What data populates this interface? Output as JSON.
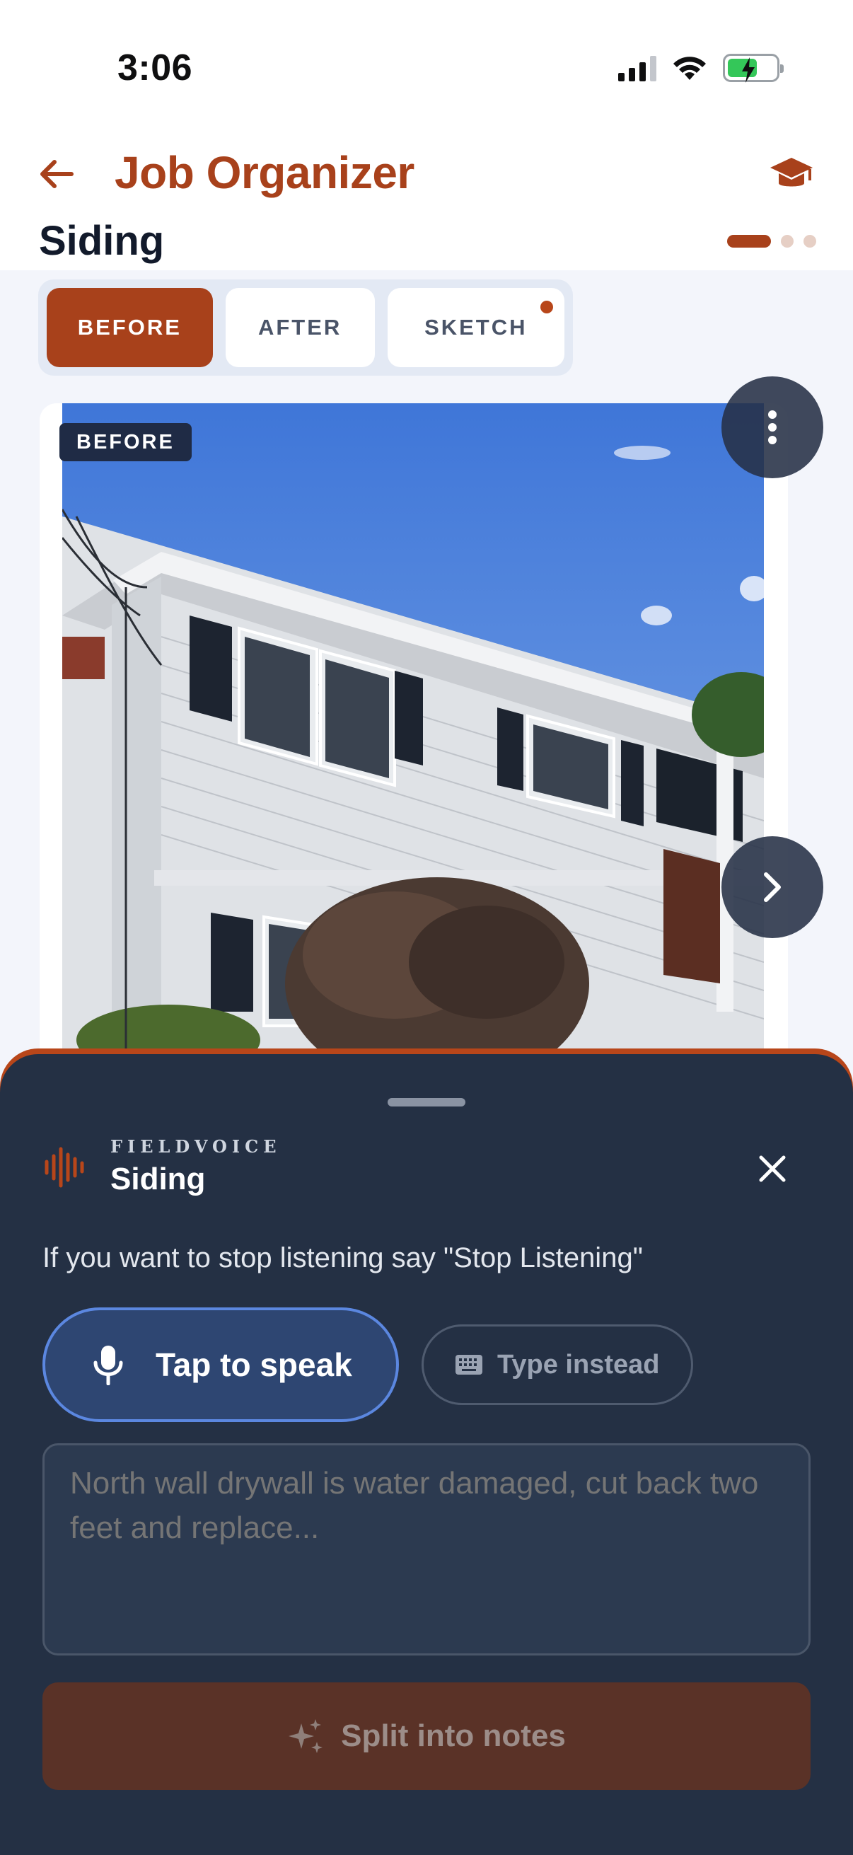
{
  "status_bar": {
    "time": "3:06"
  },
  "header": {
    "title": "Job Organizer",
    "section": "Siding"
  },
  "tabs": [
    {
      "label": "BEFORE",
      "active": true
    },
    {
      "label": "AFTER",
      "active": false
    },
    {
      "label": "SKETCH",
      "active": false,
      "has_indicator": true
    }
  ],
  "photo": {
    "badge": "BEFORE"
  },
  "pager": {
    "pages": 3,
    "current": 1
  },
  "sheet": {
    "brand": "FIELDVOICE",
    "title": "Siding",
    "hint": "If you want to stop listening say \"Stop Listening\"",
    "speak_label": "Tap to speak",
    "type_label": "Type instead",
    "input_placeholder": "North wall drywall is water damaged, cut back two feet and replace...",
    "split_label": "Split into notes"
  },
  "colors": {
    "accent": "#a8411b",
    "sheet_bg": "#243044",
    "speak_bg": "#2e4672",
    "speak_border": "#5b87e0"
  },
  "icons": {
    "back": "arrow-left-icon",
    "learn": "graduation-cap-icon",
    "more": "more-vertical-icon",
    "next": "chevron-right-icon",
    "brand": "waveform-icon",
    "close": "close-icon",
    "mic": "microphone-icon",
    "keyboard": "keyboard-icon",
    "split": "sparkles-icon"
  }
}
